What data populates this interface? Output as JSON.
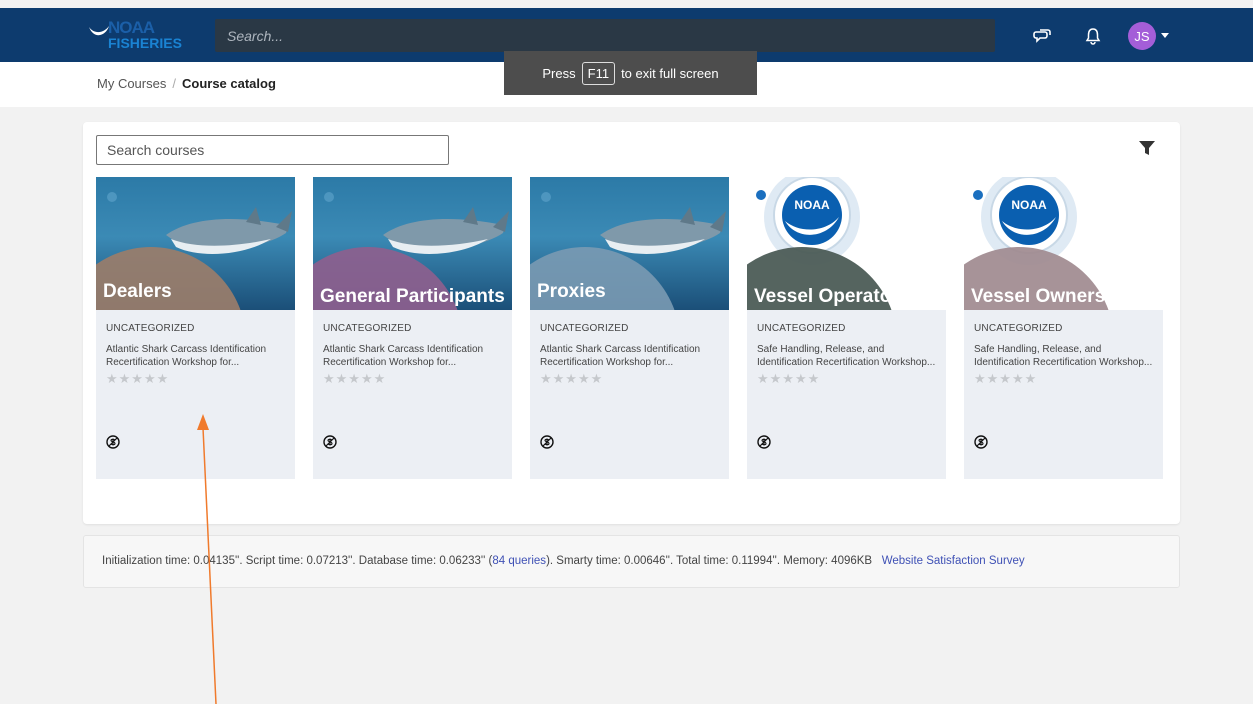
{
  "header": {
    "logo_line1": "NOAA",
    "logo_line2": "FISHERIES",
    "search_placeholder": "Search...",
    "avatar_initials": "JS"
  },
  "toast": {
    "prefix": "Press",
    "key": "F11",
    "suffix": "to exit full screen"
  },
  "breadcrumb": {
    "items": [
      "My Courses",
      "Course catalog"
    ],
    "separator": "/"
  },
  "catalog": {
    "search_placeholder": "Search courses",
    "courses": [
      {
        "thumb_label": "Dealers",
        "category": "UNCATEGORIZED",
        "title": "Atlantic Shark Carcass Identification Recertification Workshop for...",
        "rating": 0
      },
      {
        "thumb_label": "General Participants",
        "category": "UNCATEGORIZED",
        "title": "Atlantic Shark Carcass Identification Recertification Workshop for...",
        "rating": 0
      },
      {
        "thumb_label": "Proxies",
        "category": "UNCATEGORIZED",
        "title": "Atlantic Shark Carcass Identification Recertification Workshop for...",
        "rating": 0
      },
      {
        "thumb_label": "Vessel Operators",
        "category": "UNCATEGORIZED",
        "title": "Safe Handling, Release, and Identification Recertification Workshop...",
        "rating": 0
      },
      {
        "thumb_label": "Vessel Owners",
        "category": "UNCATEGORIZED",
        "title": "Safe Handling, Release, and Identification Recertification Workshop...",
        "rating": 0
      }
    ]
  },
  "footer": {
    "text_before": "Initialization time: 0.04135''. Script time: 0.07213''. Database time: 0.06233'' (",
    "queries_link": "84 queries",
    "text_after": "). Smarty time: 0.00646''. Total time: 0.11994''. Memory: 4096KB",
    "survey_link": "Website Satisfaction Survey"
  },
  "colors": {
    "nav_bg": "#0d3b6e",
    "avatar_bg": "#a45ed8",
    "annotation_arrow": "#f07a2c",
    "link": "#3f51b5"
  }
}
